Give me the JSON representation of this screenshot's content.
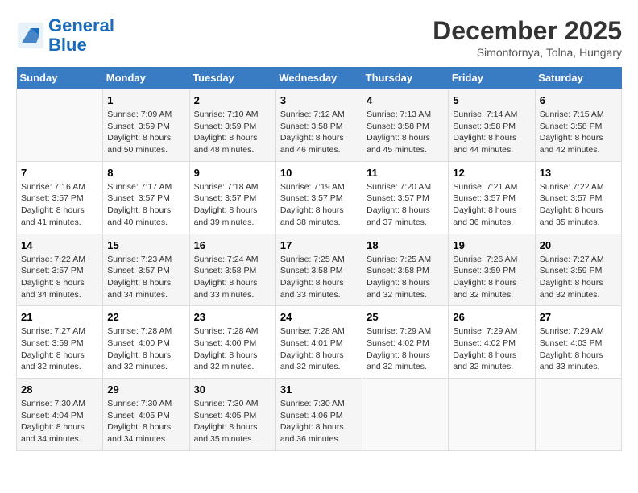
{
  "logo": {
    "line1": "General",
    "line2": "Blue"
  },
  "title": "December 2025",
  "subtitle": "Simontornya, Tolna, Hungary",
  "header": {
    "days": [
      "Sunday",
      "Monday",
      "Tuesday",
      "Wednesday",
      "Thursday",
      "Friday",
      "Saturday"
    ]
  },
  "weeks": [
    [
      {
        "num": "",
        "info": ""
      },
      {
        "num": "1",
        "info": "Sunrise: 7:09 AM\nSunset: 3:59 PM\nDaylight: 8 hours\nand 50 minutes."
      },
      {
        "num": "2",
        "info": "Sunrise: 7:10 AM\nSunset: 3:59 PM\nDaylight: 8 hours\nand 48 minutes."
      },
      {
        "num": "3",
        "info": "Sunrise: 7:12 AM\nSunset: 3:58 PM\nDaylight: 8 hours\nand 46 minutes."
      },
      {
        "num": "4",
        "info": "Sunrise: 7:13 AM\nSunset: 3:58 PM\nDaylight: 8 hours\nand 45 minutes."
      },
      {
        "num": "5",
        "info": "Sunrise: 7:14 AM\nSunset: 3:58 PM\nDaylight: 8 hours\nand 44 minutes."
      },
      {
        "num": "6",
        "info": "Sunrise: 7:15 AM\nSunset: 3:58 PM\nDaylight: 8 hours\nand 42 minutes."
      }
    ],
    [
      {
        "num": "7",
        "info": "Sunrise: 7:16 AM\nSunset: 3:57 PM\nDaylight: 8 hours\nand 41 minutes."
      },
      {
        "num": "8",
        "info": "Sunrise: 7:17 AM\nSunset: 3:57 PM\nDaylight: 8 hours\nand 40 minutes."
      },
      {
        "num": "9",
        "info": "Sunrise: 7:18 AM\nSunset: 3:57 PM\nDaylight: 8 hours\nand 39 minutes."
      },
      {
        "num": "10",
        "info": "Sunrise: 7:19 AM\nSunset: 3:57 PM\nDaylight: 8 hours\nand 38 minutes."
      },
      {
        "num": "11",
        "info": "Sunrise: 7:20 AM\nSunset: 3:57 PM\nDaylight: 8 hours\nand 37 minutes."
      },
      {
        "num": "12",
        "info": "Sunrise: 7:21 AM\nSunset: 3:57 PM\nDaylight: 8 hours\nand 36 minutes."
      },
      {
        "num": "13",
        "info": "Sunrise: 7:22 AM\nSunset: 3:57 PM\nDaylight: 8 hours\nand 35 minutes."
      }
    ],
    [
      {
        "num": "14",
        "info": "Sunrise: 7:22 AM\nSunset: 3:57 PM\nDaylight: 8 hours\nand 34 minutes."
      },
      {
        "num": "15",
        "info": "Sunrise: 7:23 AM\nSunset: 3:57 PM\nDaylight: 8 hours\nand 34 minutes."
      },
      {
        "num": "16",
        "info": "Sunrise: 7:24 AM\nSunset: 3:58 PM\nDaylight: 8 hours\nand 33 minutes."
      },
      {
        "num": "17",
        "info": "Sunrise: 7:25 AM\nSunset: 3:58 PM\nDaylight: 8 hours\nand 33 minutes."
      },
      {
        "num": "18",
        "info": "Sunrise: 7:25 AM\nSunset: 3:58 PM\nDaylight: 8 hours\nand 32 minutes."
      },
      {
        "num": "19",
        "info": "Sunrise: 7:26 AM\nSunset: 3:59 PM\nDaylight: 8 hours\nand 32 minutes."
      },
      {
        "num": "20",
        "info": "Sunrise: 7:27 AM\nSunset: 3:59 PM\nDaylight: 8 hours\nand 32 minutes."
      }
    ],
    [
      {
        "num": "21",
        "info": "Sunrise: 7:27 AM\nSunset: 3:59 PM\nDaylight: 8 hours\nand 32 minutes."
      },
      {
        "num": "22",
        "info": "Sunrise: 7:28 AM\nSunset: 4:00 PM\nDaylight: 8 hours\nand 32 minutes."
      },
      {
        "num": "23",
        "info": "Sunrise: 7:28 AM\nSunset: 4:00 PM\nDaylight: 8 hours\nand 32 minutes."
      },
      {
        "num": "24",
        "info": "Sunrise: 7:28 AM\nSunset: 4:01 PM\nDaylight: 8 hours\nand 32 minutes."
      },
      {
        "num": "25",
        "info": "Sunrise: 7:29 AM\nSunset: 4:02 PM\nDaylight: 8 hours\nand 32 minutes."
      },
      {
        "num": "26",
        "info": "Sunrise: 7:29 AM\nSunset: 4:02 PM\nDaylight: 8 hours\nand 32 minutes."
      },
      {
        "num": "27",
        "info": "Sunrise: 7:29 AM\nSunset: 4:03 PM\nDaylight: 8 hours\nand 33 minutes."
      }
    ],
    [
      {
        "num": "28",
        "info": "Sunrise: 7:30 AM\nSunset: 4:04 PM\nDaylight: 8 hours\nand 34 minutes."
      },
      {
        "num": "29",
        "info": "Sunrise: 7:30 AM\nSunset: 4:05 PM\nDaylight: 8 hours\nand 34 minutes."
      },
      {
        "num": "30",
        "info": "Sunrise: 7:30 AM\nSunset: 4:05 PM\nDaylight: 8 hours\nand 35 minutes."
      },
      {
        "num": "31",
        "info": "Sunrise: 7:30 AM\nSunset: 4:06 PM\nDaylight: 8 hours\nand 36 minutes."
      },
      {
        "num": "",
        "info": ""
      },
      {
        "num": "",
        "info": ""
      },
      {
        "num": "",
        "info": ""
      }
    ]
  ]
}
